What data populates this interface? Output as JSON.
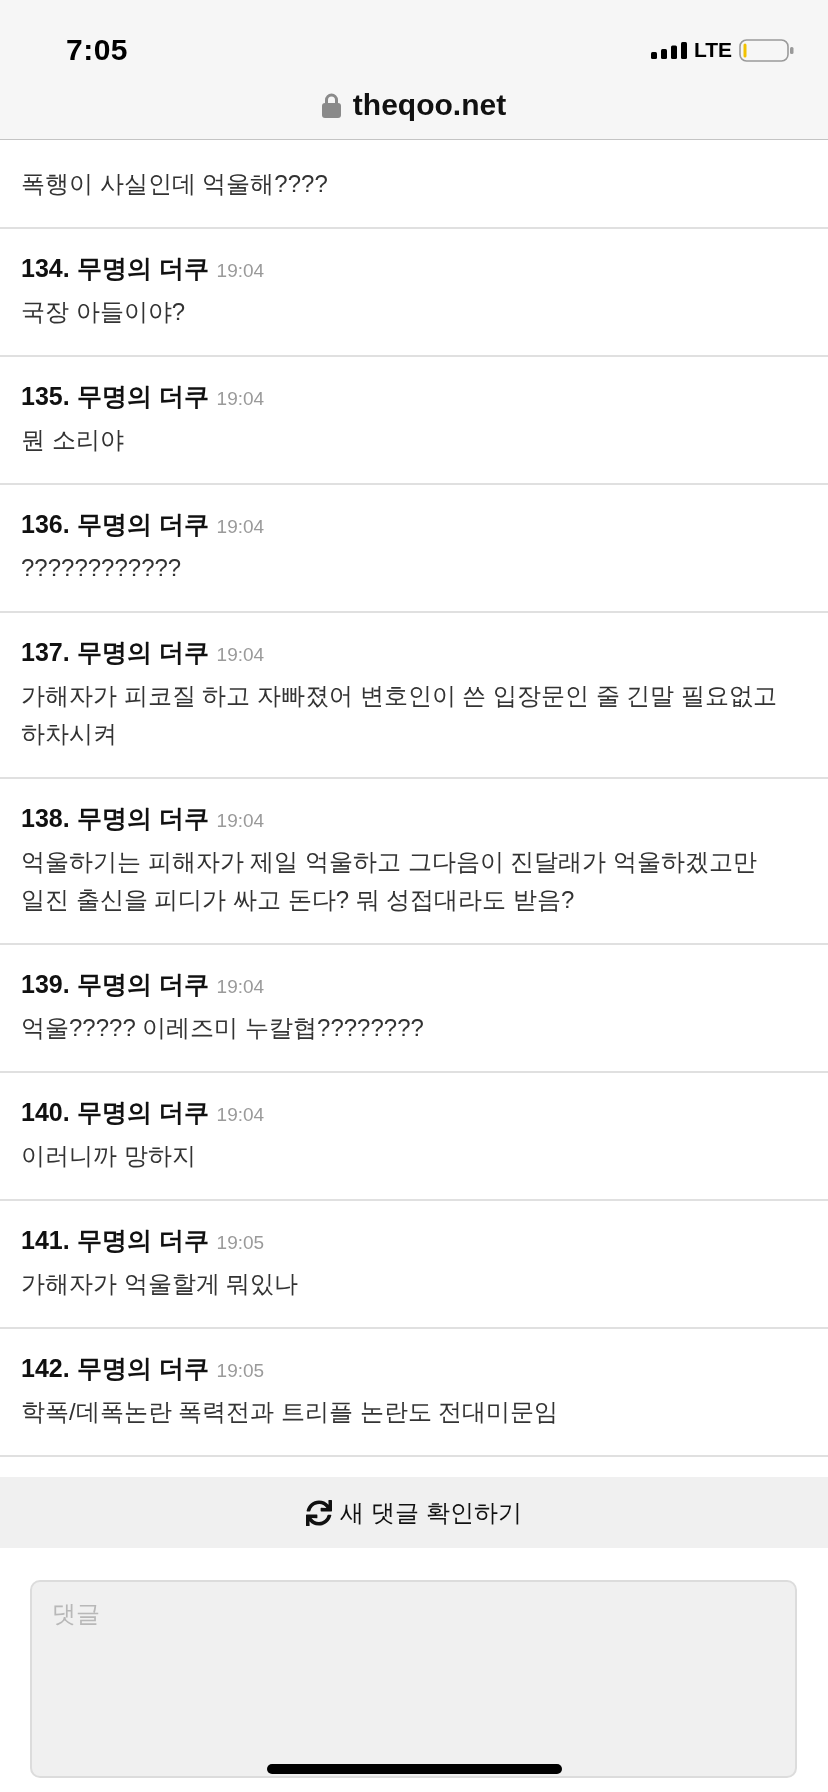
{
  "status_bar": {
    "time": "7:05",
    "network": "LTE"
  },
  "address_bar": {
    "url": "theqoo.net"
  },
  "comments": [
    {
      "body": "폭행이 사실인데 억울해????"
    },
    {
      "heading": "134. 무명의 더쿠",
      "time": "19:04",
      "body": "국장 아들이야?"
    },
    {
      "heading": "135. 무명의 더쿠",
      "time": "19:04",
      "body": "뭔 소리야"
    },
    {
      "heading": "136. 무명의 더쿠",
      "time": "19:04",
      "body": "????????????"
    },
    {
      "heading": "137. 무명의 더쿠",
      "time": "19:04",
      "body": "가해자가 피코질 하고 자빠졌어 변호인이 쓴 입장문인 줄 긴말 필요없고 하차시켜"
    },
    {
      "heading": "138. 무명의 더쿠",
      "time": "19:04",
      "body": "억울하기는 피해자가 제일 억울하고 그다음이 진달래가 억울하겠고만 일진 출신을 피디가 싸고 돈다? 뭐 성접대라도 받음?"
    },
    {
      "heading": "139. 무명의 더쿠",
      "time": "19:04",
      "body": "억울????? 이레즈미 누칼협????????"
    },
    {
      "heading": "140. 무명의 더쿠",
      "time": "19:04",
      "body": "이러니까 망하지"
    },
    {
      "heading": "141. 무명의 더쿠",
      "time": "19:05",
      "body": "가해자가 억울할게 뭐있나"
    },
    {
      "heading": "142. 무명의 더쿠",
      "time": "19:05",
      "body": "학폭/데폭논란 폭력전과 트리플 논란도 전대미문임"
    }
  ],
  "refresh_button": {
    "label": "새 댓글 확인하기"
  },
  "comment_field": {
    "placeholder": "댓글"
  }
}
